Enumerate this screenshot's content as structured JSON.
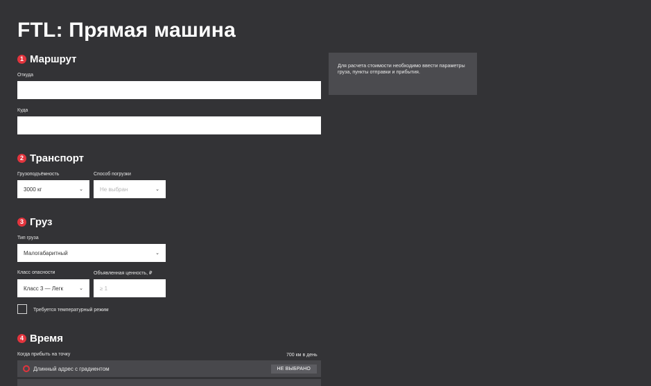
{
  "page_title": "FTL: Прямая машина",
  "route": {
    "num": "1",
    "title": "Маршрут",
    "from_label": "Откуда",
    "from_value": "",
    "to_label": "Куда",
    "to_value": ""
  },
  "transport": {
    "num": "2",
    "title": "Транспорт",
    "capacity_label": "Грузоподъёмность",
    "capacity_value": "3000 кг",
    "loading_label": "Способ погрузки",
    "loading_placeholder": "Не выбран"
  },
  "cargo": {
    "num": "3",
    "title": "Груз",
    "type_label": "Тип груза",
    "type_value": "Малогабаритный",
    "hazard_label": "Класс опасности",
    "hazard_value": "Класс 3 — Легк",
    "value_label": "Объявленная ценность, ₽",
    "value_placeholder": "≥ 1",
    "temp_label": "Требуется температурный режим",
    "temp_checked": false
  },
  "time": {
    "num": "4",
    "title": "Время",
    "arrive_label": "Когда прибыть на точку",
    "speed_note": "700 км в день",
    "address": "Длинный адрес с градиентом",
    "status": "НЕ ВЫБРАНО"
  },
  "info_text": "Для расчета стоимости необходимо ввести параметры груза, пункты отправки и прибытия.",
  "colors": {
    "background": "#333336",
    "accent": "#e2343d",
    "panel": "#4b4b4f"
  },
  "icons": {
    "select": "chevron-down-icon",
    "address": "radio-circle-icon"
  }
}
